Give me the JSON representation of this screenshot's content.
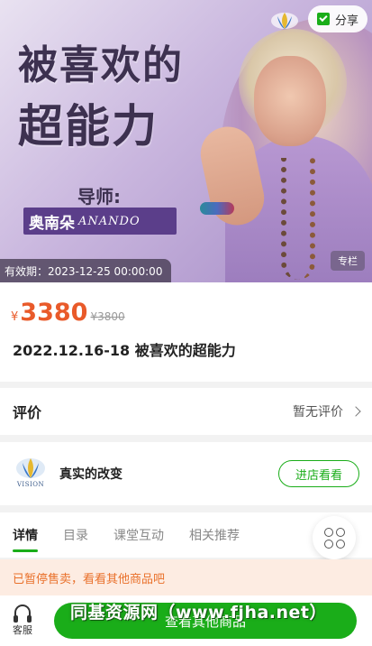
{
  "banner": {
    "title_line1": "被喜欢的",
    "title_line2": "超能力",
    "mentor_label": "导师:",
    "mentor_name": "奥南朵",
    "mentor_name_en": "ANANDO",
    "validity": "有效期：2023-12-25 00:00:00",
    "column_tag": "专栏",
    "share_label": "分享"
  },
  "price": {
    "currency": "¥",
    "current": "3380",
    "original": "¥3800"
  },
  "course_title": "2022.12.16-18 被喜欢的超能力",
  "review": {
    "label": "评价",
    "status": "暂无评价"
  },
  "shop": {
    "logo_text": "VISION",
    "name": "真实的改变",
    "enter_label": "进店看看"
  },
  "tabs": [
    {
      "label": "详情",
      "active": true
    },
    {
      "label": "目录",
      "active": false
    },
    {
      "label": "课堂互动",
      "active": false
    },
    {
      "label": "相关推荐",
      "active": false
    }
  ],
  "notice": "已暂停售卖，看看其他商品吧",
  "bottom": {
    "service_label": "客服",
    "button_label": "查看其他商品"
  },
  "watermark": "同基资源网（www.fjha.net）",
  "colors": {
    "accent_green": "#1aad19",
    "price_orange": "#e95a2a",
    "notice_bg": "#fdece2"
  }
}
